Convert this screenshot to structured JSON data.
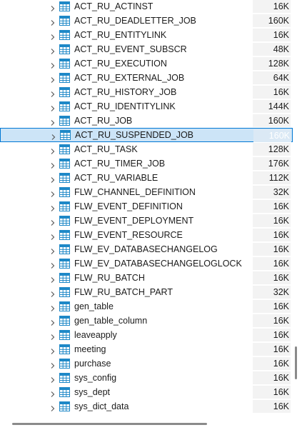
{
  "tree": {
    "rows": [
      {
        "name": "ACT_RU_ACTINST",
        "size": "16K"
      },
      {
        "name": "ACT_RU_DEADLETTER_JOB",
        "size": "160K"
      },
      {
        "name": "ACT_RU_ENTITYLINK",
        "size": "16K"
      },
      {
        "name": "ACT_RU_EVENT_SUBSCR",
        "size": "48K"
      },
      {
        "name": "ACT_RU_EXECUTION",
        "size": "128K"
      },
      {
        "name": "ACT_RU_EXTERNAL_JOB",
        "size": "64K"
      },
      {
        "name": "ACT_RU_HISTORY_JOB",
        "size": "16K"
      },
      {
        "name": "ACT_RU_IDENTITYLINK",
        "size": "144K"
      },
      {
        "name": "ACT_RU_JOB",
        "size": "160K"
      },
      {
        "name": "ACT_RU_SUSPENDED_JOB",
        "size": "160K",
        "selected": true
      },
      {
        "name": "ACT_RU_TASK",
        "size": "128K"
      },
      {
        "name": "ACT_RU_TIMER_JOB",
        "size": "176K"
      },
      {
        "name": "ACT_RU_VARIABLE",
        "size": "112K"
      },
      {
        "name": "FLW_CHANNEL_DEFINITION",
        "size": "32K"
      },
      {
        "name": "FLW_EVENT_DEFINITION",
        "size": "16K"
      },
      {
        "name": "FLW_EVENT_DEPLOYMENT",
        "size": "16K"
      },
      {
        "name": "FLW_EVENT_RESOURCE",
        "size": "16K"
      },
      {
        "name": "FLW_EV_DATABASECHANGELOG",
        "size": "16K"
      },
      {
        "name": "FLW_EV_DATABASECHANGELOGLOCK",
        "size": "16K"
      },
      {
        "name": "FLW_RU_BATCH",
        "size": "16K"
      },
      {
        "name": "FLW_RU_BATCH_PART",
        "size": "32K"
      },
      {
        "name": "gen_table",
        "size": "16K"
      },
      {
        "name": "gen_table_column",
        "size": "16K"
      },
      {
        "name": "leaveapply",
        "size": "16K"
      },
      {
        "name": "meeting",
        "size": "16K"
      },
      {
        "name": "purchase",
        "size": "16K"
      },
      {
        "name": "sys_config",
        "size": "16K"
      },
      {
        "name": "sys_dept",
        "size": "16K"
      },
      {
        "name": "sys_dict_data",
        "size": "16K"
      }
    ],
    "icons": {
      "expand": "chevron-right-icon",
      "table": "table-icon"
    },
    "colors": {
      "selection_bg": "#cce4f7",
      "selection_border": "#0078d4",
      "table_icon": "#1e88c7",
      "size_bg": "#f3f3f3"
    }
  }
}
